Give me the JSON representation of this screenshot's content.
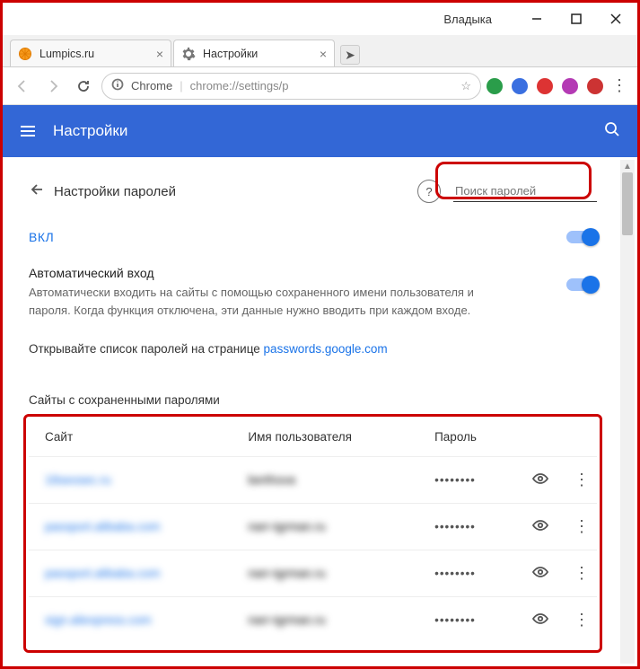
{
  "window": {
    "user_label": "Владыка"
  },
  "tabs": [
    {
      "title": "Lumpics.ru",
      "favicon": "orange-icon"
    },
    {
      "title": "Настройки",
      "favicon": "gear-icon"
    }
  ],
  "omnibox": {
    "scheme_label": "Chrome",
    "url": "chrome://settings/p"
  },
  "settings_header": {
    "title": "Настройки"
  },
  "subheader": {
    "title": "Настройки паролей",
    "search_placeholder": "Поиск паролей"
  },
  "toggles": {
    "on_label": "ВКЛ",
    "autosignin_heading": "Автоматический вход",
    "autosignin_desc": "Автоматически входить на сайты с помощью сохраненного имени пользователя и пароля. Когда функция отключена, эти данные нужно вводить при каждом входе."
  },
  "password_link": {
    "prefix": "Открывайте список паролей на странице ",
    "link_text": "passwords.google.com"
  },
  "saved": {
    "heading": "Сайты с сохраненными паролями",
    "columns": {
      "site": "Сайт",
      "user": "Имя пользователя",
      "pass": "Пароль"
    },
    "rows": [
      {
        "site": "18seosec.ru",
        "user": "berthova",
        "pass": "••••••••"
      },
      {
        "site": "passport.alibaba.com",
        "user": "narr-tgrman.ru",
        "pass": "••••••••"
      },
      {
        "site": "passport.alibaba.com",
        "user": "narr-tgrman.ru",
        "pass": "••••••••"
      },
      {
        "site": "sign.aliexpress.com",
        "user": "narr-tgrman.ru",
        "pass": "••••••••"
      }
    ]
  }
}
